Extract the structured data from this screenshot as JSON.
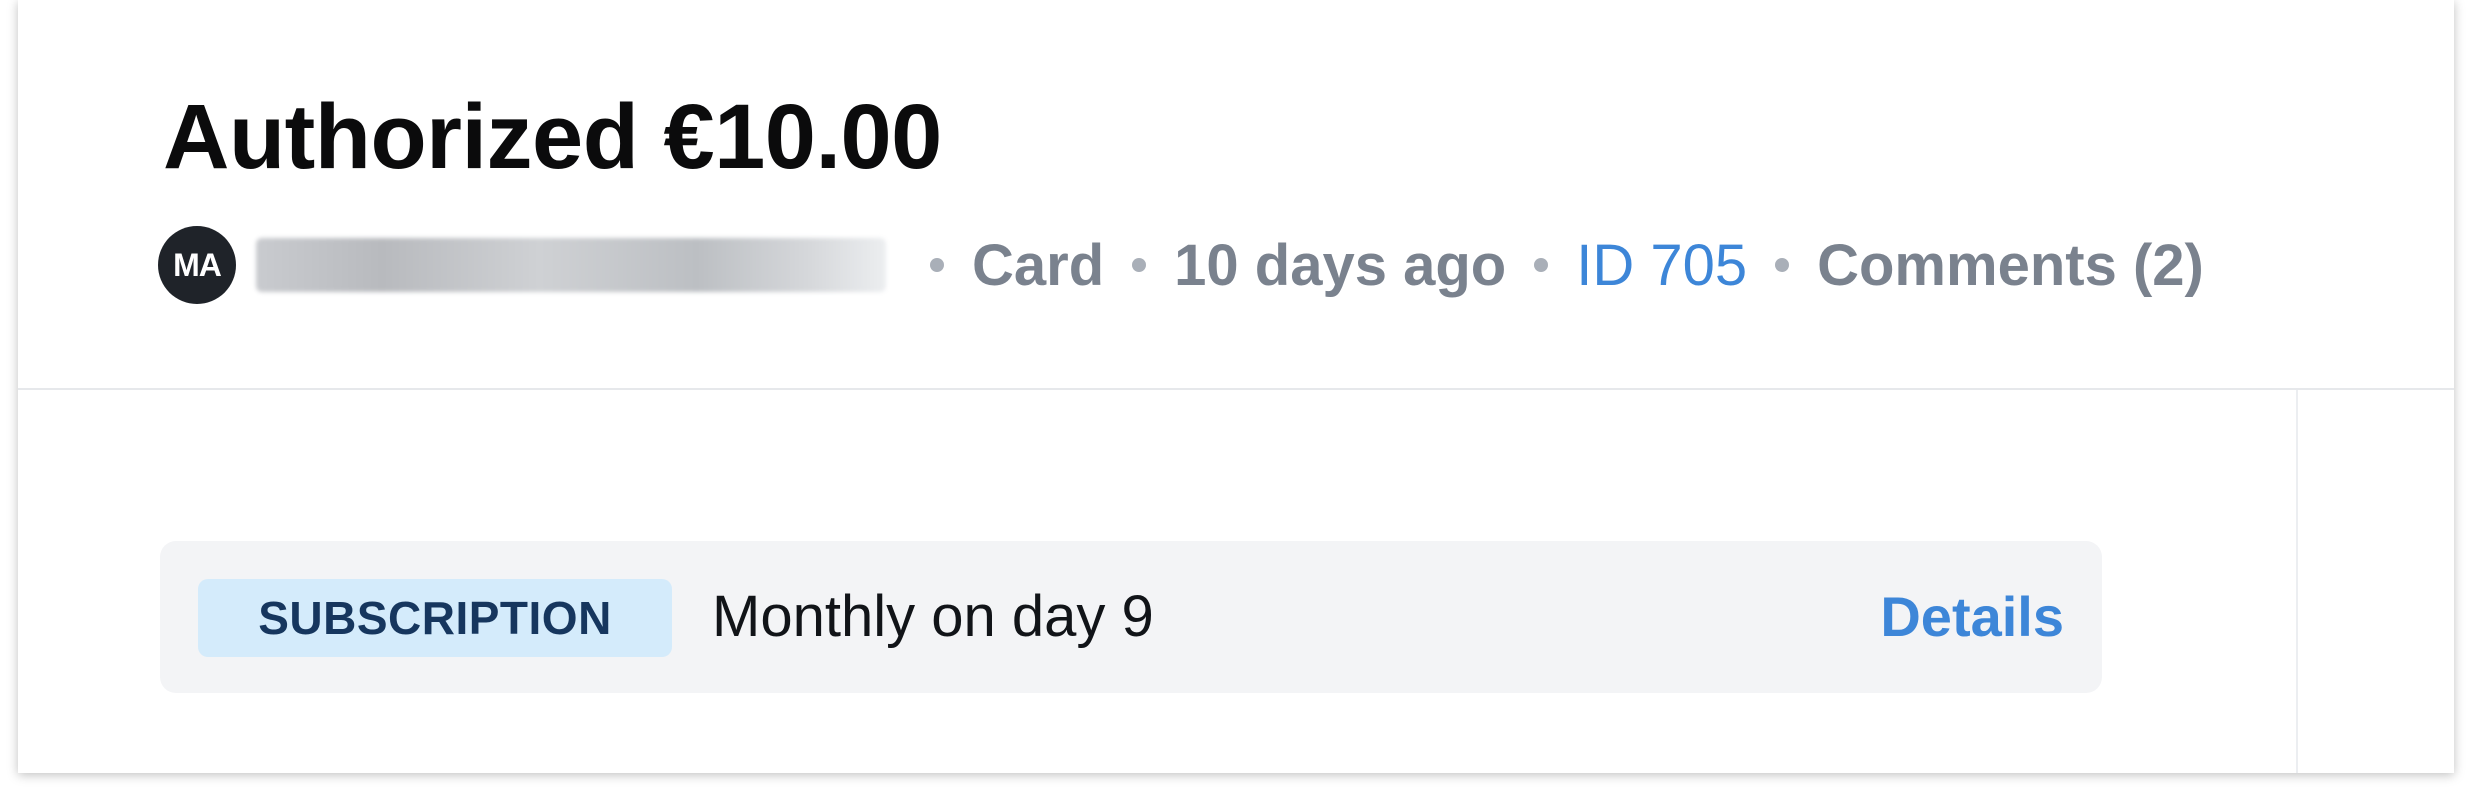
{
  "header": {
    "title": "Authorized €10.00"
  },
  "meta": {
    "avatar_initials": "MA",
    "method": "Card",
    "time": "10 days ago",
    "id_link": "ID 705",
    "comments": "Comments (2)"
  },
  "subscription": {
    "badge": "SUBSCRIPTION",
    "schedule": "Monthly on day 9",
    "details_label": "Details"
  },
  "colors": {
    "link": "#3d86d8",
    "badge_bg": "#d4ebfb",
    "badge_text": "#16365e",
    "muted_text": "#7a828e"
  }
}
